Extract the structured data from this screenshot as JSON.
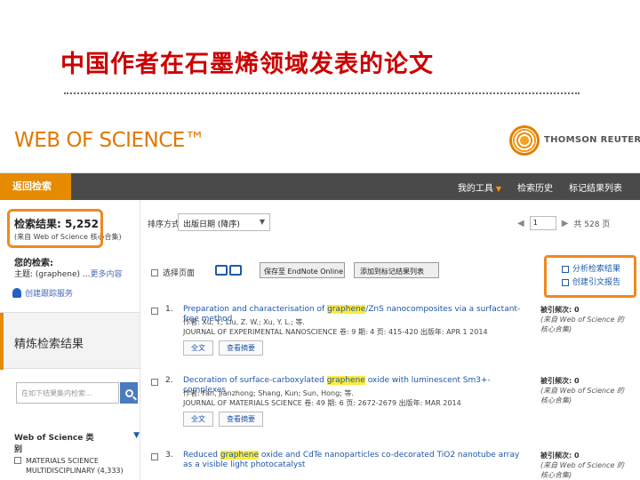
{
  "slide": {
    "title": "中国作者在石墨烯领域发表的论文"
  },
  "header": {
    "logo": "WEB OF SCIENCE™",
    "publisher": "THOMSON REUTERS®"
  },
  "topbar": {
    "back_label": "返回检索",
    "nav": [
      {
        "label": "我的工具"
      },
      {
        "label": "检索历史"
      },
      {
        "label": "标记结果列表"
      }
    ]
  },
  "left": {
    "results_label": "检索结果: 5,252",
    "results_note": "(来自 Web of Science 核心合集)",
    "query_label": "您的检索:",
    "query_text": "主题: (graphene) ...",
    "query_more": "更多内容",
    "alert_label": "创建跟踪服务",
    "refine_title": "精炼检索结果",
    "refine_placeholder": "在如下结果集内检索...",
    "category_header": "Web of Science 类别",
    "category_item": "MATERIALS SCIENCE MULTIDISCIPLINARY (4,333)"
  },
  "main": {
    "sort_label": "排序方式:",
    "sort_value": "出版日期 (降序)",
    "pager": {
      "page": "1",
      "of_text": "共 528 页"
    },
    "select_page": "选择页面",
    "save_button": "保存至 EndNote Online",
    "mark_button": "添加到标记结果列表",
    "analyze_label": "分析检索结果",
    "citation_report_label": "创建引文报告",
    "records": [
      {
        "num": "1.",
        "title_pre": "Preparation and characterisation of ",
        "title_hl": "graphene",
        "title_post": "/ZnS nanocomposites via a surfactant-free method",
        "authors": "作者: Xu, Y.; Liu, Z. W.; Xu, Y. L.; 等.",
        "journal": "JOURNAL OF EXPERIMENTAL NANOSCIENCE 卷: 9 期: 4 页: 415-420 出版年: APR 1 2014",
        "links": [
          "全文",
          "查看摘要"
        ],
        "cites_label": "被引频次: 0",
        "cites_note": "(来自 Web of Science 的核心合集)"
      },
      {
        "num": "2.",
        "title_pre": "Decoration of surface-carboxylated ",
        "title_hl": "graphene",
        "title_post": " oxide with luminescent Sm3+-complexes",
        "authors": "作者: Fan, Jianzhong; Shang, Kun; Sun, Hong; 等.",
        "journal": "JOURNAL OF MATERIALS SCIENCE 卷: 49 期: 6 页: 2672-2679 出版年: MAR 2014",
        "links": [
          "全文",
          "查看摘要"
        ],
        "cites_label": "被引频次: 0",
        "cites_note": "(来自 Web of Science 的核心合集)"
      },
      {
        "num": "3.",
        "title_pre": "Reduced ",
        "title_hl": "graphene",
        "title_post": " oxide and CdTe nanoparticles co-decorated TiO2 nanotube array as a visible light photocatalyst",
        "authors": "",
        "journal": "",
        "links": [],
        "cites_label": "被引频次: 0",
        "cites_note": "(来自 Web of Science 的核心合集)"
      }
    ]
  },
  "colors": {
    "title_red": "#cc0000",
    "accent_orange": "#e68a00",
    "link_blue": "#1f56a8",
    "highlight": "#ffeb3b"
  }
}
